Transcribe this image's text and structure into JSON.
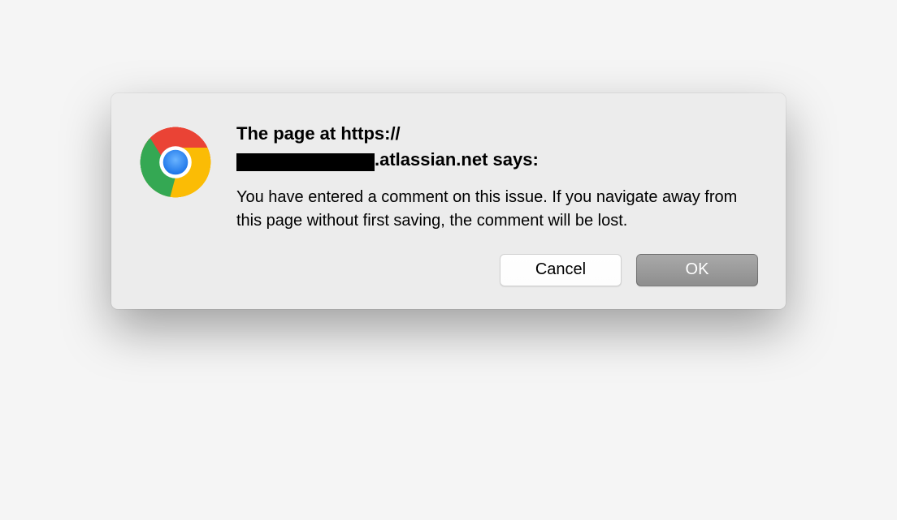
{
  "dialog": {
    "title_line1": "The page at https://",
    "title_suffix": ".atlassian.net says:",
    "message": "You have entered a comment on this issue. If you navigate away from this page without first saving, the comment will be lost.",
    "buttons": {
      "cancel": "Cancel",
      "ok": "OK"
    }
  }
}
